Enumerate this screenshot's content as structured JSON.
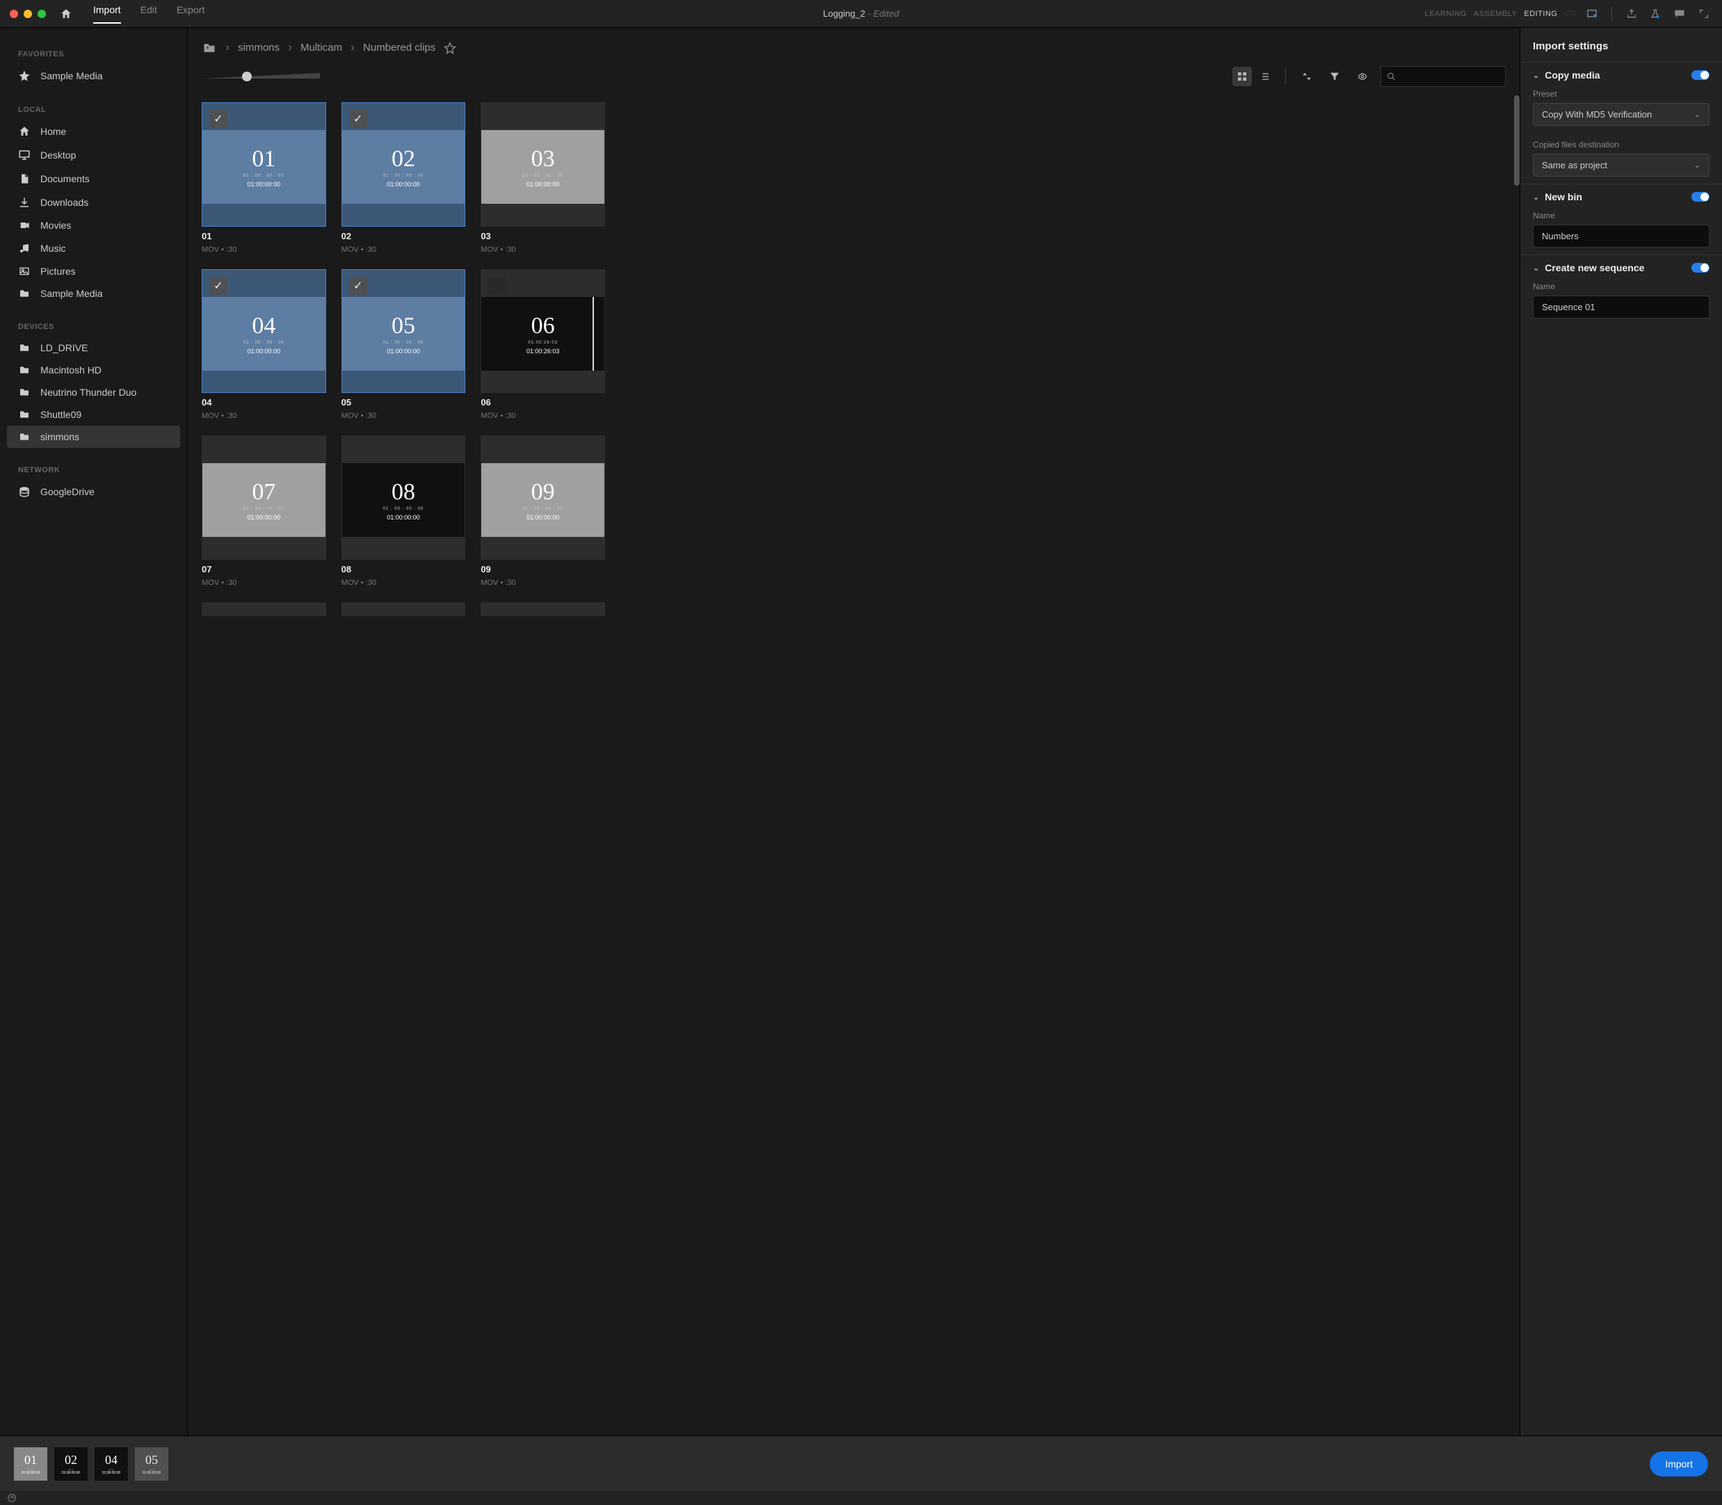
{
  "window": {
    "title": "Logging_2",
    "edited": " - Edited"
  },
  "menu": {
    "import": "Import",
    "edit": "Edit",
    "export": "Export"
  },
  "workspace": {
    "learning": "LEARNING",
    "assembly": "ASSEMBLY",
    "editing": "EDITING",
    "more": "CO"
  },
  "sidebar": {
    "favorites": {
      "label": "FAVORITES",
      "items": [
        {
          "label": "Sample Media"
        }
      ]
    },
    "local": {
      "label": "LOCAL",
      "items": [
        {
          "label": "Home"
        },
        {
          "label": "Desktop"
        },
        {
          "label": "Documents"
        },
        {
          "label": "Downloads"
        },
        {
          "label": "Movies"
        },
        {
          "label": "Music"
        },
        {
          "label": "Pictures"
        },
        {
          "label": "Sample Media"
        }
      ]
    },
    "devices": {
      "label": "DEVICES",
      "items": [
        {
          "label": "LD_DRIVE"
        },
        {
          "label": "Macintosh HD"
        },
        {
          "label": "Neutrino Thunder Duo"
        },
        {
          "label": "Shuttle09"
        },
        {
          "label": "simmons",
          "selected": true
        }
      ]
    },
    "network": {
      "label": "NETWORK",
      "items": [
        {
          "label": "GoogleDrive"
        }
      ]
    }
  },
  "breadcrumb": {
    "a": "simmons",
    "b": "Multicam",
    "c": "Numbered clips"
  },
  "clips": [
    {
      "num": "01",
      "name": "01",
      "tc": "01:00:00:00",
      "meta": "MOV  •  :30",
      "selected": true,
      "light": true
    },
    {
      "num": "02",
      "name": "02",
      "tc": "01:00:00:00",
      "meta": "MOV  •  :30",
      "selected": true,
      "light": true
    },
    {
      "num": "03",
      "name": "03",
      "tc": "01:00:00:00",
      "meta": "MOV  •  :30",
      "selected": false,
      "light": true
    },
    {
      "num": "04",
      "name": "04",
      "tc": "01:00:00:00",
      "meta": "MOV  •  :30",
      "selected": true,
      "light": true
    },
    {
      "num": "05",
      "name": "05",
      "tc": "01:00:00:00",
      "meta": "MOV  •  :30",
      "selected": true,
      "light": true
    },
    {
      "num": "06",
      "name": "06",
      "tc": "01:00:26:03",
      "meta": "MOV  •  :30",
      "selected": false,
      "dark": true,
      "hover": true,
      "scrub": true,
      "sub": "01:00:26:03"
    },
    {
      "num": "07",
      "name": "07",
      "tc": "01:00:00:00",
      "meta": "MOV  •  :30",
      "selected": false,
      "light": true
    },
    {
      "num": "08",
      "name": "08",
      "tc": "01:00:00:00",
      "meta": "MOV  •  :30",
      "selected": false,
      "dark": true
    },
    {
      "num": "09",
      "name": "09",
      "tc": "01:00:00:00",
      "meta": "MOV  •  :30",
      "selected": false,
      "light": true
    }
  ],
  "settings": {
    "title": "Import settings",
    "copy": {
      "label": "Copy media",
      "preset_label": "Preset",
      "preset_value": "Copy With MD5 Verification",
      "dest_label": "Copied files destination",
      "dest_value": "Same as project"
    },
    "bin": {
      "label": "New bin",
      "name_label": "Name",
      "name_value": "Numbers"
    },
    "seq": {
      "label": "Create new sequence",
      "name_label": "Name",
      "name_value": "Sequence 01"
    }
  },
  "tray": {
    "items": [
      "01",
      "02",
      "04",
      "05"
    ],
    "button": "Import"
  }
}
